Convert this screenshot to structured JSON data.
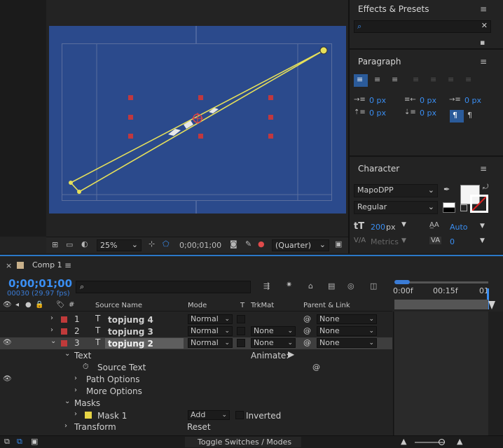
{
  "viewer_toolbar": {
    "zoom": "25%",
    "timecode": "0;00;01;00",
    "resolution": "(Quarter)"
  },
  "effects_presets": {
    "title": "Effects & Presets",
    "search_placeholder": ""
  },
  "paragraph": {
    "title": "Paragraph",
    "indent_left": "0 px",
    "indent_first": "0 px",
    "indent_right": "0 px",
    "space_before": "0 px",
    "space_after": "0 px"
  },
  "character": {
    "title": "Character",
    "font_family": "MapoDPP",
    "font_style": "Regular",
    "font_size": "200",
    "font_size_unit": "px",
    "leading": "Auto",
    "kerning": "Metrics",
    "tracking": "0"
  },
  "timeline": {
    "comp_name": "Comp 1",
    "timecode": "0;00;01;00",
    "frame_info": "00030 (29.97 fps)",
    "col_source": "Source Name",
    "col_mode": "Mode",
    "col_t": "T",
    "col_trkmat": "TrkMat",
    "col_parent": "Parent & Link",
    "ruler_0": "0:00f",
    "ruler_15": "00:15f",
    "ruler_01": "01",
    "layers": [
      {
        "num": "1",
        "name": "topjung 4",
        "mode": "Normal",
        "trkmat": "",
        "parent": "None"
      },
      {
        "num": "2",
        "name": "topjung 3",
        "mode": "Normal",
        "trkmat": "None",
        "parent": "None"
      },
      {
        "num": "3",
        "name": "topjung 2",
        "mode": "Normal",
        "trkmat": "None",
        "parent": "None"
      }
    ],
    "props": {
      "text": "Text",
      "animate": "Animate:",
      "source_text": "Source Text",
      "path_options": "Path Options",
      "more_options": "More Options",
      "masks": "Masks",
      "mask1": "Mask 1",
      "mask_mode": "Add",
      "inverted": "Inverted",
      "transform": "Transform",
      "reset": "Reset"
    },
    "toggle_label": "Toggle Switches / Modes"
  },
  "colors": {
    "accent": "#3a8ef2",
    "label_red": "#c03a3a",
    "canvas_blue": "#2b4a8c",
    "path_yellow": "#e6e05a"
  }
}
